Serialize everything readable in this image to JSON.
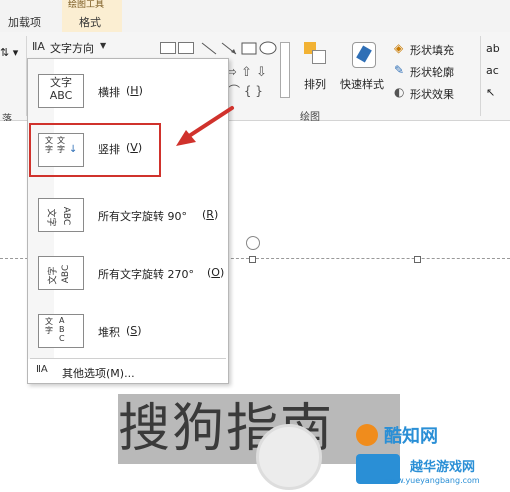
{
  "tabs": {
    "addins": "加载项",
    "context_title": "绘图工具",
    "format": "格式"
  },
  "ribbon": {
    "text_direction": "文字方向",
    "arrange": "排列",
    "quick_styles": "快速样式",
    "shape_fill": "形状填充",
    "shape_outline": "形状轮廓",
    "shape_effects": "形状效果",
    "group_drawing": "绘图",
    "group_paragraph": "落"
  },
  "menu": {
    "items": [
      {
        "label": "横排",
        "key": "H",
        "icon_text_a": "文字",
        "icon_text_b": "ABC"
      },
      {
        "label": "竖排",
        "key": "V",
        "icon_text_a": "文字",
        "icon_text_b": "文字"
      },
      {
        "label": "所有文字旋转 90°",
        "key": "R",
        "icon_text_a": "文字",
        "icon_text_b": "ABC"
      },
      {
        "label": "所有文字旋转 270°",
        "key": "O",
        "icon_text_a": "文字",
        "icon_text_b": "ABC"
      },
      {
        "label": "堆积",
        "key": "S",
        "icon_text_a": "文字",
        "icon_text_b": "ABC"
      }
    ],
    "more_options": "其他选项(M)..."
  },
  "slide": {
    "big_text": "搜狗指南"
  },
  "watermark": {
    "brand": "酷知网",
    "brand2": "越华游戏网",
    "url": "www.yueyangbang.com"
  },
  "colors": {
    "highlight": "#d0322c",
    "context_tab": "#fbeed2"
  }
}
